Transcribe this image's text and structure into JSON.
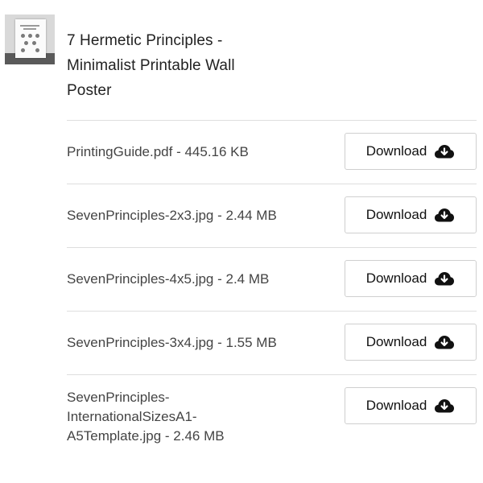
{
  "product": {
    "title_line1": "7 Hermetic Principles -",
    "title_line2": "Minimalist Printable Wall",
    "title_line3": "Poster",
    "thumbnail_icon": "poster-thumbnail"
  },
  "download_label": "Download",
  "download_icon": "cloud-download-icon",
  "files": [
    {
      "name": "PrintingGuide.pdf - 445.16 KB"
    },
    {
      "name": "SevenPrinciples-2x3.jpg - 2.44 MB"
    },
    {
      "name": "SevenPrinciples-4x5.jpg - 2.4 MB"
    },
    {
      "name": "SevenPrinciples-3x4.jpg - 1.55 MB"
    },
    {
      "name_line1": "SevenPrinciples-",
      "name_line2": "InternationalSizesA1-",
      "name_line3": "A5Template.jpg - 2.46 MB"
    }
  ],
  "colors": {
    "text": "#222222",
    "secondary_text": "#444444",
    "divider": "#dedede",
    "button_border": "#cfcfcf"
  }
}
